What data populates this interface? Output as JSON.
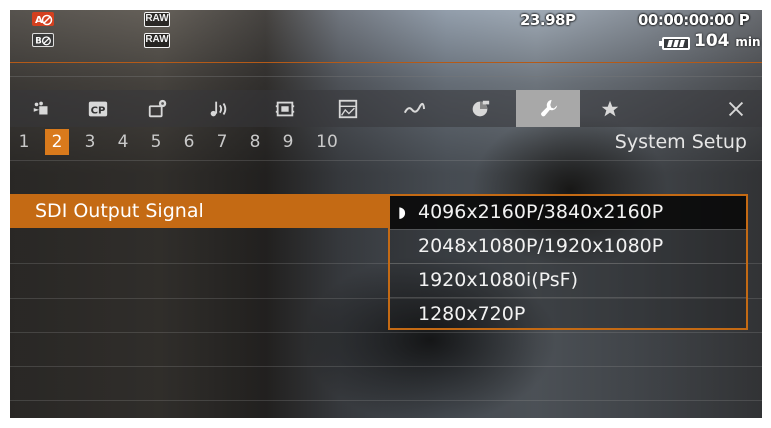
{
  "status": {
    "icon_top_left_1": "record-lock-icon",
    "icon_top_left_2": "b-lock-icon",
    "raw_badge_1": "RAW",
    "raw_badge_2": "RAW",
    "frame_rate": "23.98P",
    "timecode": "00:00:00:00 P",
    "battery_value": "104",
    "battery_unit": "min"
  },
  "tabs": [
    {
      "name": "camera-icon",
      "active": false
    },
    {
      "name": "custom-picture-icon",
      "label": "CP",
      "active": false
    },
    {
      "name": "camera-settings-icon",
      "active": false
    },
    {
      "name": "audio-icon",
      "active": false
    },
    {
      "name": "recording-media-icon",
      "active": false
    },
    {
      "name": "assistance-functions-icon",
      "active": false
    },
    {
      "name": "monitoring-icon",
      "active": false
    },
    {
      "name": "network-icon",
      "active": false
    },
    {
      "name": "system-setup-wrench-icon",
      "active": true
    },
    {
      "name": "my-menu-star-icon",
      "active": false
    },
    {
      "name": "close-icon",
      "active": false
    }
  ],
  "pages": [
    "1",
    "2",
    "3",
    "4",
    "5",
    "6",
    "7",
    "8",
    "9",
    "10"
  ],
  "active_page": "2",
  "page_title": "System Setup",
  "setting": {
    "label": "SDI Output Signal"
  },
  "options": [
    {
      "label": "4096x2160P/3840x2160P",
      "selected": true
    },
    {
      "label": "2048x1080P/1920x1080P",
      "selected": false
    },
    {
      "label": "1920x1080i(PsF)",
      "selected": false
    },
    {
      "label": "1280x720P",
      "selected": false
    }
  ],
  "colors": {
    "accent": "#c46a14",
    "active_page_bg": "#d97a1c",
    "active_tab_bg": "#a8a8a8"
  }
}
